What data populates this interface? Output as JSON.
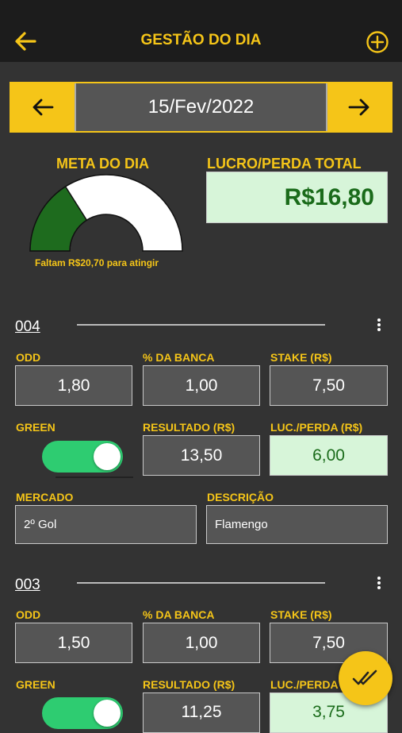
{
  "header": {
    "title": "GESTÃO DO DIA"
  },
  "date_nav": {
    "date": "15/Fev/2022"
  },
  "summary": {
    "goal_label": "META DO DIA",
    "goal_fraction": 0.32,
    "goal_note": "Faltam R$20,70 para atingir",
    "total_label": "LUCRO/PERDA TOTAL",
    "total_value": "R$16,80"
  },
  "field_labels": {
    "odd": "ODD",
    "bank_pct": "% DA BANCA",
    "stake": "STAKE (R$)",
    "green": "GREEN",
    "result": "RESULTADO (R$)",
    "profit": "LUC./PERDA (R$)",
    "market": "MERCADO",
    "description": "DESCRIÇÃO"
  },
  "entries": [
    {
      "id": "004",
      "odd": "1,80",
      "bank_pct": "1,00",
      "stake": "7,50",
      "green": true,
      "result": "13,50",
      "profit": "6,00",
      "market": "2º Gol",
      "description": "Flamengo"
    },
    {
      "id": "003",
      "odd": "1,50",
      "bank_pct": "1,00",
      "stake": "7,50",
      "green": true,
      "result": "11,25",
      "profit": "3,75"
    }
  ],
  "colors": {
    "accent": "#f5c518",
    "background": "#333333",
    "topbar": "#1c1c1c",
    "profit_bg": "#d7f5d9",
    "profit_text": "#1a6b1a",
    "toggle_on": "#2ecc71",
    "gauge_fill": "#1e6b1e"
  }
}
